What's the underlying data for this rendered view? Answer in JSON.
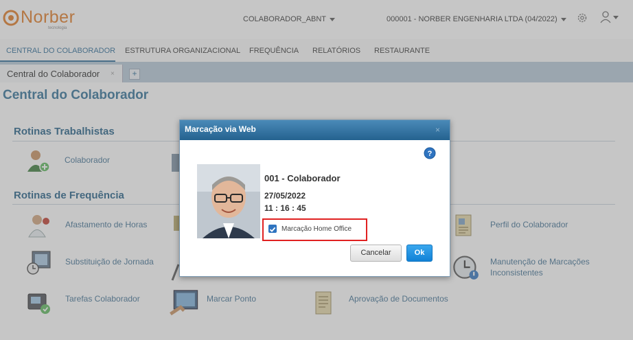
{
  "header": {
    "logo_text": "Norber",
    "logo_tagline": "tecnologia",
    "user_selector": "COLABORADOR_ABNT",
    "company_selector": "000001 - NORBER ENGENHARIA LTDA (04/2022)"
  },
  "menu": {
    "items": [
      "CENTRAL DO COLABORADOR",
      "ESTRUTURA ORGANIZACIONAL",
      "FREQUÊNCIA",
      "RELATÓRIOS",
      "RESTAURANTE"
    ],
    "active_index": 0
  },
  "tabs": {
    "items": [
      {
        "label": "Central do Colaborador",
        "close": "×"
      }
    ],
    "add_label": "+"
  },
  "page": {
    "title": "Central do Colaborador",
    "sections": [
      {
        "title": "Rotinas Trabalhistas",
        "items": [
          {
            "label": "Colaborador",
            "icon": "user-add-icon"
          }
        ]
      },
      {
        "title": "Rotinas de Frequência",
        "items": [
          {
            "label": "Afastamento de Horas",
            "icon": "doctor-icon"
          },
          {
            "label": "Perfil do Colaborador",
            "icon": "profile-document-icon"
          },
          {
            "label": "Substituição de Jornada",
            "icon": "schedule-swap-icon"
          },
          {
            "label": "Manutenção de Marcações",
            "icon": "clock-settings-icon"
          },
          {
            "label": "Inconsistentes",
            "icon": "clock-settings-icon"
          },
          {
            "label": "Tarefas Colaborador",
            "icon": "time-clock-icon"
          },
          {
            "label": "Marcar Ponto",
            "icon": "punch-clock-icon"
          },
          {
            "label": "Aprovação de Documentos",
            "icon": "document-approve-icon"
          }
        ]
      }
    ]
  },
  "dialog": {
    "title": "Marcação via Web",
    "close": "×",
    "help": "?",
    "employee": "001 - Colaborador",
    "date": "27/05/2022",
    "time": "11 : 16 : 45",
    "home_office_label": "Marcação Home Office",
    "home_office_checked": true,
    "cancel_label": "Cancelar",
    "ok_label": "Ok"
  },
  "colors": {
    "brand": "#e07820",
    "accent": "#2a6a96",
    "dialog_header": "#24628f",
    "ok_button": "#1182d6",
    "highlight_border": "#e02020"
  }
}
